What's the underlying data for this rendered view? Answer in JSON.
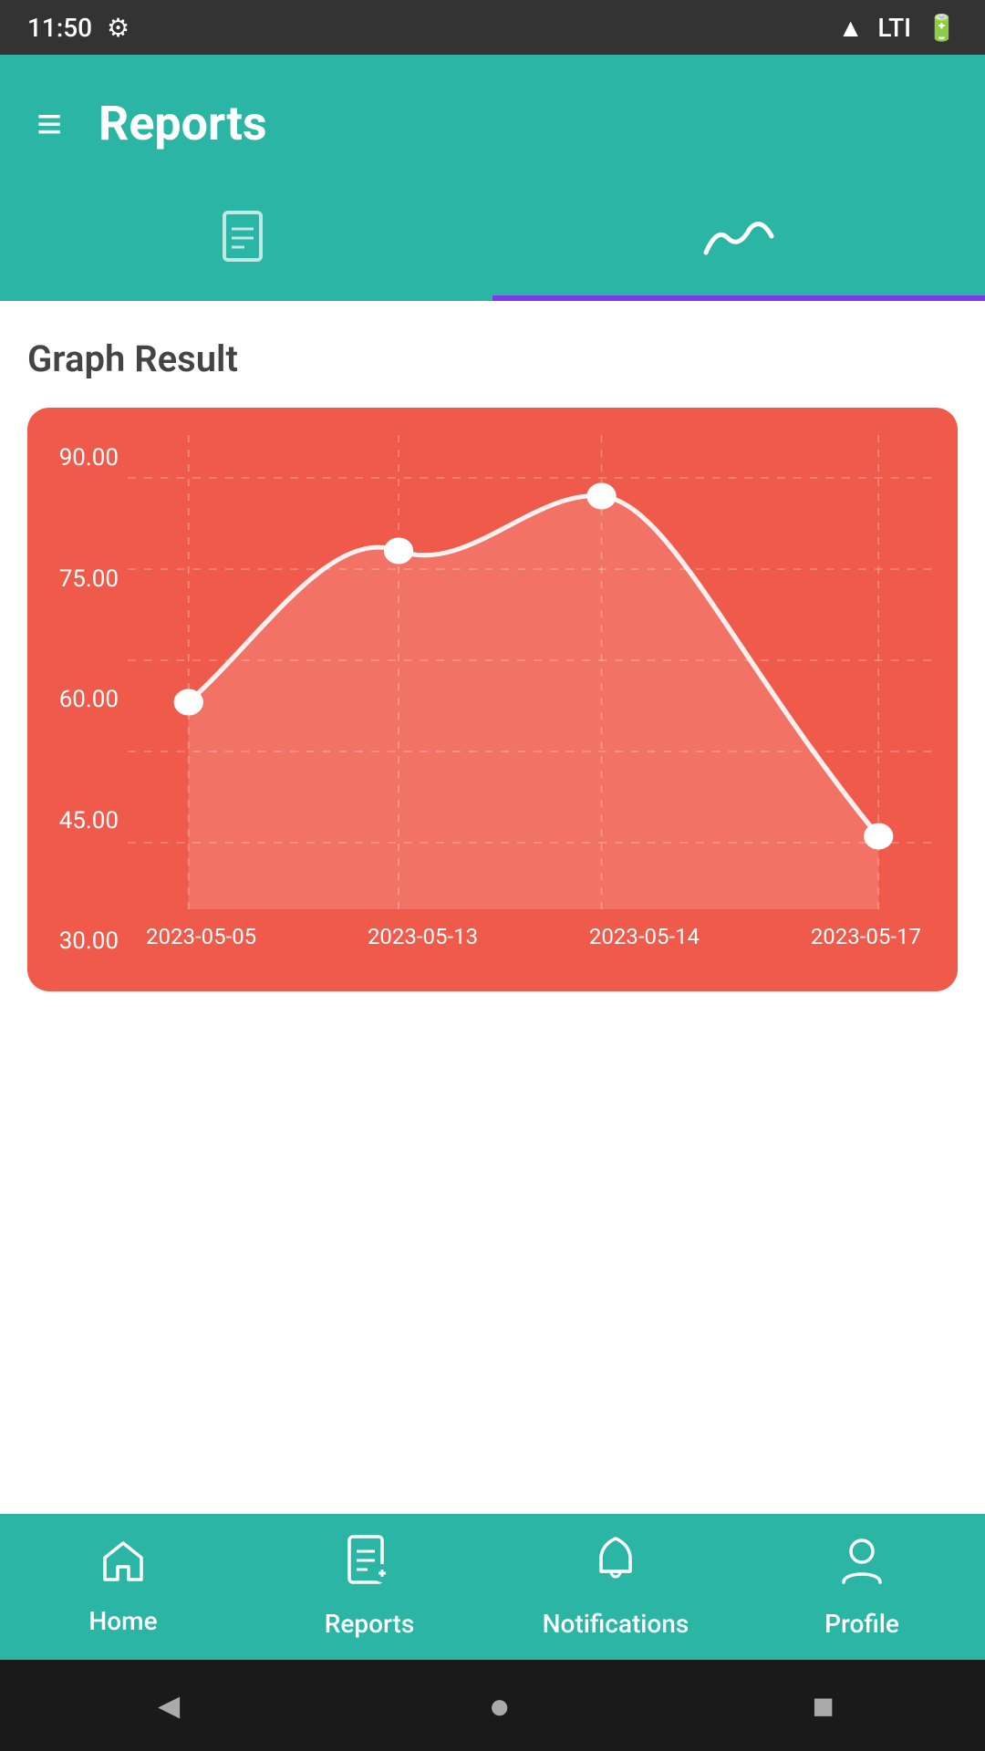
{
  "statusBar": {
    "time": "11:50",
    "icons": {
      "settings": "⚙",
      "wifi": "wifi",
      "signal": "LTI",
      "battery": "battery"
    }
  },
  "appBar": {
    "menuIcon": "≡",
    "title": "Reports"
  },
  "tabs": [
    {
      "id": "list",
      "icon": "📄",
      "active": false
    },
    {
      "id": "graph",
      "icon": "〰",
      "active": true
    }
  ],
  "graphResult": {
    "title": "Graph Result",
    "yLabels": [
      "90.00",
      "75.00",
      "60.00",
      "45.00",
      "30.00"
    ],
    "xLabels": [
      "2023-05-05",
      "2023-05-13",
      "2023-05-14",
      "2023-05-17"
    ],
    "dataPoints": [
      {
        "date": "2023-05-05",
        "value": 53
      },
      {
        "date": "2023-05-13",
        "value": 78
      },
      {
        "date": "2023-05-14",
        "value": 87
      },
      {
        "date": "2023-05-17",
        "value": 31
      }
    ],
    "yMin": 22,
    "yMax": 97
  },
  "bottomNav": {
    "items": [
      {
        "id": "home",
        "label": "Home",
        "icon": "home"
      },
      {
        "id": "reports",
        "label": "Reports",
        "icon": "reports",
        "active": true
      },
      {
        "id": "notifications",
        "label": "Notifications",
        "icon": "bell"
      },
      {
        "id": "profile",
        "label": "Profile",
        "icon": "person"
      }
    ]
  },
  "androidNav": {
    "back": "◄",
    "home": "●",
    "recent": "■"
  }
}
